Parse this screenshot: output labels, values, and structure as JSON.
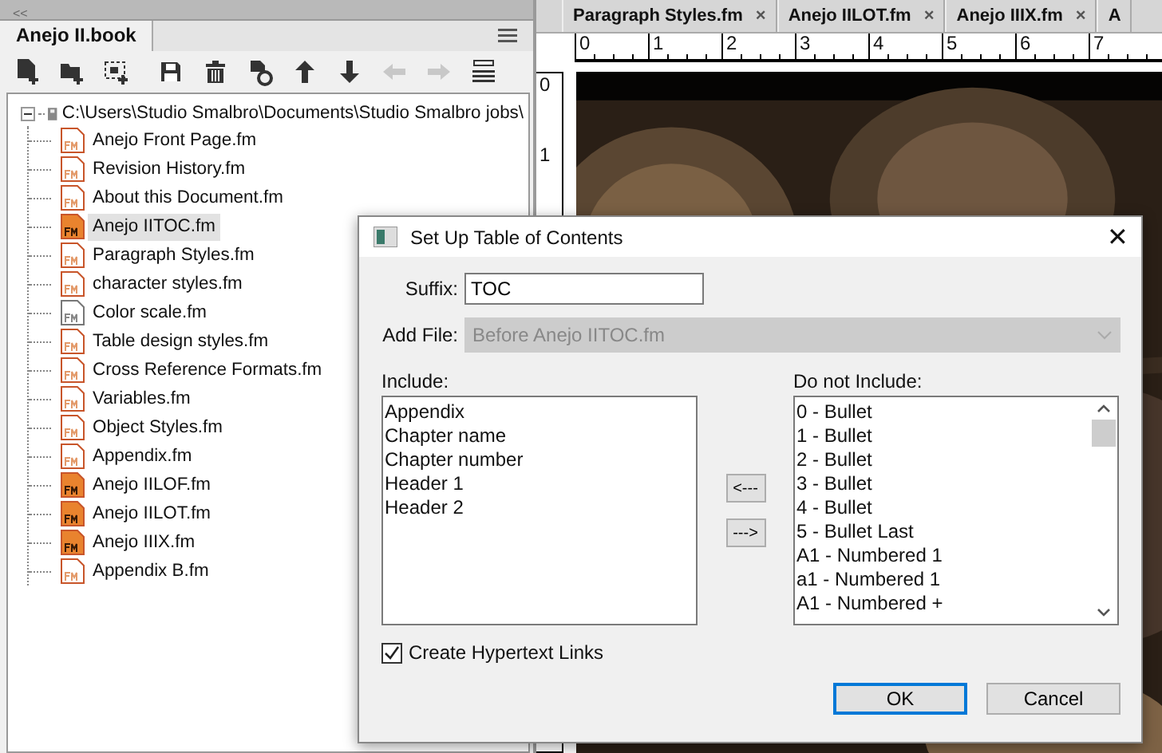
{
  "collapse_bar": {
    "label": "<<"
  },
  "book_panel": {
    "tab": "Anejo II.book",
    "toolbar": [
      {
        "kind": "addfile",
        "disabled": false
      },
      {
        "kind": "addfolder",
        "disabled": false
      },
      {
        "kind": "addgroup",
        "disabled": false
      },
      {
        "kind": "save",
        "disabled": false
      },
      {
        "kind": "delete",
        "disabled": false
      },
      {
        "kind": "update",
        "disabled": false
      },
      {
        "kind": "up",
        "disabled": false
      },
      {
        "kind": "down",
        "disabled": false
      },
      {
        "kind": "left",
        "disabled": true
      },
      {
        "kind": "right",
        "disabled": true
      },
      {
        "kind": "menu",
        "disabled": false
      }
    ],
    "tree": [
      {
        "label": "C:\\Users\\Studio Smalbro\\Documents\\Studio Smalbro jobs\\",
        "expanded": true,
        "selected": false,
        "children": [
          {
            "label": "Anejo Front Page.fm",
            "kind": "document",
            "selected": false
          },
          {
            "label": "Revision History.fm",
            "kind": "document",
            "selected": false
          },
          {
            "label": "About this Document.fm",
            "kind": "document",
            "selected": false
          },
          {
            "label": "Anejo IITOC.fm",
            "kind": "generated",
            "selected": true
          },
          {
            "label": "Paragraph Styles.fm",
            "kind": "document",
            "selected": false
          },
          {
            "label": "character styles.fm",
            "kind": "document",
            "selected": false
          },
          {
            "label": "Color scale.fm",
            "kind": "plain",
            "selected": false
          },
          {
            "label": "Table design styles.fm",
            "kind": "document",
            "selected": false
          },
          {
            "label": "Cross Reference Formats.fm",
            "kind": "document",
            "selected": false
          },
          {
            "label": "Variables.fm",
            "kind": "document",
            "selected": false
          },
          {
            "label": "Object Styles.fm",
            "kind": "document",
            "selected": false
          },
          {
            "label": "Appendix.fm",
            "kind": "document",
            "selected": false
          },
          {
            "label": "Anejo IILOF.fm",
            "kind": "generated",
            "selected": false
          },
          {
            "label": "Anejo IILOT.fm",
            "kind": "generated",
            "selected": false
          },
          {
            "label": "Anejo IIIX.fm",
            "kind": "generated",
            "selected": false
          },
          {
            "label": "Appendix B.fm",
            "kind": "document",
            "selected": false
          }
        ]
      }
    ]
  },
  "document_tabs": [
    {
      "label": "Paragraph Styles.fm",
      "close": "×"
    },
    {
      "label": "Anejo IILOT.fm",
      "close": "×"
    },
    {
      "label": "Anejo IIIX.fm",
      "close": "×"
    },
    {
      "label": "A"
    }
  ],
  "ruler": {
    "marks": [
      "0",
      "1",
      "2",
      "3",
      "4",
      "5",
      "6",
      "7"
    ],
    "vertical_marks": [
      "0",
      "1"
    ]
  },
  "dialog": {
    "title": "Set Up Table of Contents",
    "close": "✕",
    "suffix": {
      "label": "Suffix:",
      "value": "TOC"
    },
    "add_file": {
      "label": "Add File:",
      "value": "Before Anejo IITOC.fm",
      "disabled": true
    },
    "include": {
      "label": "Include:",
      "items": [
        "Appendix",
        "Chapter name",
        "Chapter number",
        "Header 1",
        "Header 2"
      ]
    },
    "move_buttons": [
      "<---",
      "--->"
    ],
    "exclude": {
      "label": "Do not Include:",
      "items": [
        "0 - Bullet",
        "1 - Bullet",
        "2 - Bullet",
        "3 - Bullet",
        "4 - Bullet",
        "5 - Bullet Last",
        "A1 - Numbered 1",
        "a1 - Numbered 1",
        "A1 - Numbered +"
      ]
    },
    "hypertext": {
      "label": "Create Hypertext Links",
      "checked": true
    },
    "buttons": [
      {
        "label": "OK",
        "default": true
      },
      {
        "label": "Cancel",
        "default": false
      }
    ]
  }
}
